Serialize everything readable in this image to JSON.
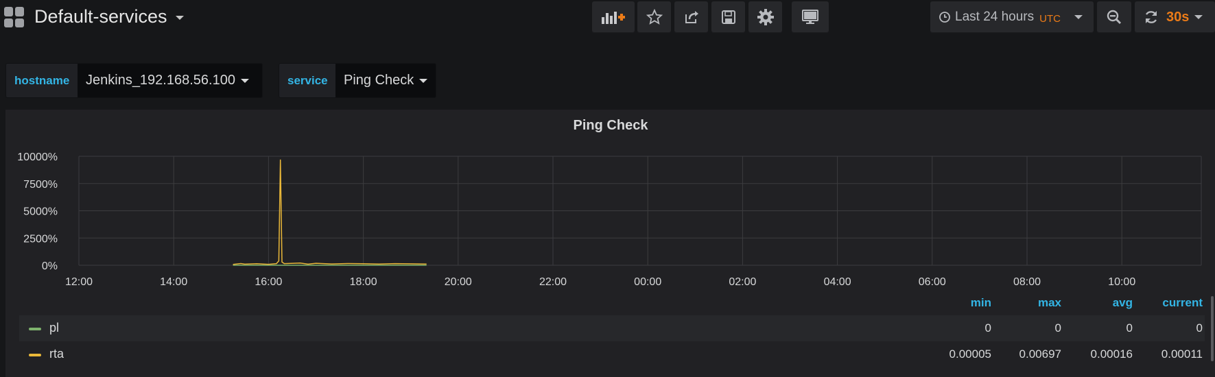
{
  "header": {
    "title": "Default-services",
    "time_range": "Last 24 hours",
    "timezone": "UTC",
    "refresh": "30s"
  },
  "variables": [
    {
      "label": "hostname",
      "value": "Jenkins_192.168.56.100"
    },
    {
      "label": "service",
      "value": "Ping Check"
    }
  ],
  "panel": {
    "title": "Ping Check",
    "legend_columns": [
      "min",
      "max",
      "avg",
      "current"
    ],
    "legend": [
      {
        "name": "pl",
        "color": "#7eb26d",
        "min": "0",
        "max": "0",
        "avg": "0",
        "current": "0"
      },
      {
        "name": "rta",
        "color": "#eab839",
        "min": "0.00005",
        "max": "0.00697",
        "avg": "0.00016",
        "current": "0.00011"
      }
    ]
  },
  "chart_data": {
    "type": "line",
    "y_ticks": [
      "10000%",
      "7500%",
      "5000%",
      "2500%",
      "0%"
    ],
    "y_tick_values": [
      10000,
      7500,
      5000,
      2500,
      0
    ],
    "x_ticks": [
      "12:00",
      "14:00",
      "16:00",
      "18:00",
      "20:00",
      "22:00",
      "00:00",
      "02:00",
      "04:00",
      "06:00",
      "08:00",
      "10:00"
    ],
    "ylim": [
      0,
      10000
    ],
    "grid": true,
    "series": [
      {
        "name": "pl",
        "color": "#7eb26d",
        "x": [
          "15:15",
          "19:20"
        ],
        "values": [
          0,
          0
        ]
      },
      {
        "name": "rta",
        "color": "#eab839",
        "x": [
          "15:15",
          "15:25",
          "15:30",
          "15:45",
          "16:00",
          "16:10",
          "16:13",
          "16:15",
          "16:17",
          "16:20",
          "16:40",
          "16:50",
          "17:00",
          "17:20",
          "17:40",
          "18:00",
          "18:20",
          "18:40",
          "19:00",
          "19:20"
        ],
        "values": [
          80,
          160,
          100,
          140,
          90,
          150,
          400,
          9700,
          300,
          150,
          200,
          100,
          180,
          120,
          160,
          140,
          110,
          150,
          130,
          110
        ]
      }
    ]
  }
}
